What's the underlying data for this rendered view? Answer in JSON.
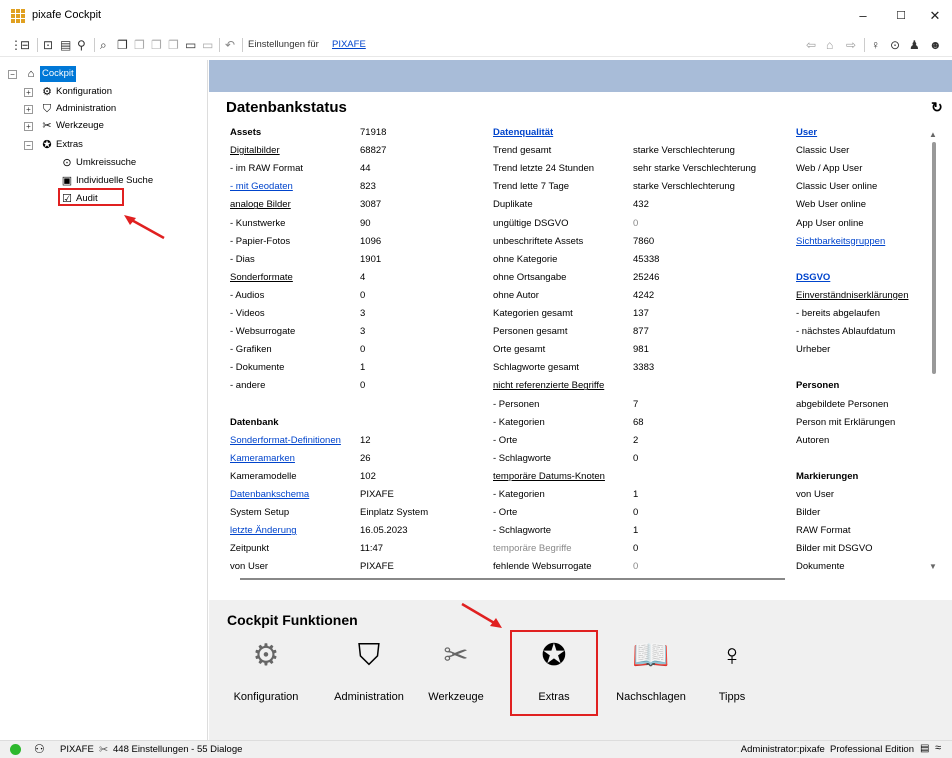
{
  "window": {
    "title": "pixafe Cockpit",
    "min": "–",
    "max": "☐",
    "close": "✕"
  },
  "toolbar": {
    "label": "Einstellungen für",
    "link": "PIXAFE"
  },
  "tree": [
    {
      "label": "Cockpit",
      "level": 0,
      "icon": "museum-icon",
      "exp": "⊟"
    },
    {
      "label": "Konfiguration",
      "level": 1,
      "icon": "gears-icon",
      "exp": "⊞"
    },
    {
      "label": "Administration",
      "level": 1,
      "icon": "shield-icon",
      "exp": "⊞"
    },
    {
      "label": "Werkzeuge",
      "level": 1,
      "icon": "tools-icon",
      "exp": "⊞"
    },
    {
      "label": "Extras",
      "level": 1,
      "icon": "star-icon",
      "exp": "⊟"
    },
    {
      "label": "Umkreissuche",
      "level": 2,
      "icon": "location-icon"
    },
    {
      "label": "Individuelle Suche",
      "level": 2,
      "icon": "search-icon"
    },
    {
      "label": "Audit",
      "level": 2,
      "icon": "audit-icon"
    }
  ],
  "db": {
    "title": "Datenbankstatus"
  },
  "col1": [
    {
      "l": "Assets",
      "v": "71918",
      "s": "b"
    },
    {
      "l": "Digitalbilder",
      "v": "68827",
      "s": "u"
    },
    {
      "l": " - im RAW Format",
      "v": "44",
      "s": ""
    },
    {
      "l": " - mit Geodaten",
      "v": "823",
      "s": "lnk"
    },
    {
      "l": "analoge Bilder",
      "v": "3087",
      "s": "u"
    },
    {
      "l": " - Kunstwerke",
      "v": "90",
      "s": ""
    },
    {
      "l": " - Papier-Fotos",
      "v": "1096",
      "s": ""
    },
    {
      "l": " - Dias",
      "v": "1901",
      "s": ""
    },
    {
      "l": "Sonderformate",
      "v": "4",
      "s": "u"
    },
    {
      "l": " - Audios",
      "v": "0",
      "s": ""
    },
    {
      "l": " - Videos",
      "v": "3",
      "s": ""
    },
    {
      "l": " - Websurrogate",
      "v": "3",
      "s": ""
    },
    {
      "l": " - Grafiken",
      "v": "0",
      "s": ""
    },
    {
      "l": " - Dokumente",
      "v": "1",
      "s": ""
    },
    {
      "l": " - andere",
      "v": "0",
      "s": ""
    },
    {
      "l": "",
      "v": "",
      "s": ""
    },
    {
      "l": "Datenbank",
      "v": "",
      "s": "b"
    },
    {
      "l": "Sonderformat-Definitionen",
      "v": "12",
      "s": "lnk"
    },
    {
      "l": "Kameramarken",
      "v": "26",
      "s": "lnk"
    },
    {
      "l": "Kameramodelle",
      "v": "102",
      "s": ""
    },
    {
      "l": "Datenbankschema",
      "v": "PIXAFE",
      "s": "lnk"
    },
    {
      "l": "System Setup",
      "v": "Einplatz System",
      "s": ""
    },
    {
      "l": "letzte Änderung",
      "v": "16.05.2023",
      "s": "lnk"
    },
    {
      "l": "Zeitpunkt",
      "v": "11:47",
      "s": ""
    },
    {
      "l": "von User",
      "v": "PIXAFE",
      "s": ""
    }
  ],
  "col2": [
    {
      "l": "Datenqualität",
      "v": "",
      "s": "lnkb"
    },
    {
      "l": "Trend gesamt",
      "v": "starke Verschlechterung",
      "s": ""
    },
    {
      "l": "Trend letzte 24 Stunden",
      "v": "sehr starke Verschlechterung",
      "s": ""
    },
    {
      "l": "Trend lette 7 Tage",
      "v": "starke Verschlechterung",
      "s": ""
    },
    {
      "l": "Duplikate",
      "v": "432",
      "s": ""
    },
    {
      "l": "ungültige DSGVO",
      "v": "0",
      "s": "gv"
    },
    {
      "l": "unbeschriftete Assets",
      "v": "7860",
      "s": ""
    },
    {
      "l": "ohne Kategorie",
      "v": "45338",
      "s": ""
    },
    {
      "l": "ohne Ortsangabe",
      "v": "25246",
      "s": ""
    },
    {
      "l": "ohne Autor",
      "v": "4242",
      "s": ""
    },
    {
      "l": "Kategorien gesamt",
      "v": "137",
      "s": ""
    },
    {
      "l": "Personen gesamt",
      "v": "877",
      "s": ""
    },
    {
      "l": "Orte gesamt",
      "v": "981",
      "s": ""
    },
    {
      "l": "Schlagworte gesamt",
      "v": "3383",
      "s": ""
    },
    {
      "l": "nicht referenzierte Begriffe",
      "v": "",
      "s": "u"
    },
    {
      "l": " - Personen",
      "v": "7",
      "s": ""
    },
    {
      "l": " - Kategorien",
      "v": "68",
      "s": ""
    },
    {
      "l": " - Orte",
      "v": "2",
      "s": ""
    },
    {
      "l": " - Schlagworte",
      "v": "0",
      "s": ""
    },
    {
      "l": "temporäre Datums-Knoten",
      "v": "",
      "s": "u"
    },
    {
      "l": " - Kategorien",
      "v": "1",
      "s": ""
    },
    {
      "l": " - Orte",
      "v": "0",
      "s": ""
    },
    {
      "l": " - Schlagworte",
      "v": "1",
      "s": ""
    },
    {
      "l": "temporäre Begriffe",
      "v": "0",
      "s": "gl"
    },
    {
      "l": "fehlende Websurrogate",
      "v": "0",
      "s": "gv"
    }
  ],
  "col3": [
    {
      "l": "User",
      "s": "lnkb"
    },
    {
      "l": "Classic User",
      "s": ""
    },
    {
      "l": "Web / App User",
      "s": ""
    },
    {
      "l": "Classic User online",
      "s": ""
    },
    {
      "l": "Web User online",
      "s": ""
    },
    {
      "l": "App User online",
      "s": ""
    },
    {
      "l": "Sichtbarkeitsgruppen",
      "s": "lnk"
    },
    {
      "l": "",
      "s": ""
    },
    {
      "l": "DSGVO",
      "s": "lnkb"
    },
    {
      "l": "Einverständniserklärungen",
      "s": "u"
    },
    {
      "l": " - bereits abgelaufen",
      "s": ""
    },
    {
      "l": " - nächstes Ablaufdatum",
      "s": ""
    },
    {
      "l": "Urheber",
      "s": ""
    },
    {
      "l": "",
      "s": ""
    },
    {
      "l": "Personen",
      "s": "b"
    },
    {
      "l": "abgebildete Personen",
      "s": ""
    },
    {
      "l": "Person mit Erklärungen",
      "s": ""
    },
    {
      "l": "Autoren",
      "s": ""
    },
    {
      "l": "",
      "s": ""
    },
    {
      "l": "Markierungen",
      "s": "b"
    },
    {
      "l": "von User",
      "s": ""
    },
    {
      "l": "Bilder",
      "s": ""
    },
    {
      "l": "RAW Format",
      "s": ""
    },
    {
      "l": "Bilder mit DSGVO",
      "s": ""
    },
    {
      "l": "Dokumente",
      "s": ""
    }
  ],
  "functions": {
    "title": "Cockpit Funktionen",
    "items": [
      {
        "label": "Konfiguration",
        "icon": "gears-icon"
      },
      {
        "label": "Administration",
        "icon": "shield-icon"
      },
      {
        "label": "Werkzeuge",
        "icon": "tools-icon"
      },
      {
        "label": "Extras",
        "icon": "star-icon"
      },
      {
        "label": "Nachschlagen",
        "icon": "book-reader-icon"
      },
      {
        "label": "Tipps",
        "icon": "lightbulb-icon"
      }
    ]
  },
  "status": {
    "left": "PIXAFE",
    "center": "448 Einstellungen - 55 Dialoge",
    "right": "Administrator:pixafe  Professional Edition"
  },
  "colors": {
    "accent": "#0078d7",
    "banner": "#a8bcd8",
    "link": "#0044cc",
    "annotation": "#e02020"
  }
}
